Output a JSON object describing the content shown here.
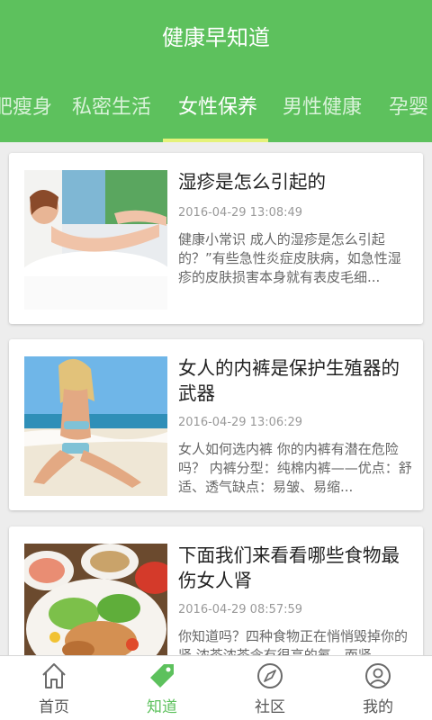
{
  "header": {
    "title": "健康早知道"
  },
  "tabs": [
    {
      "label": "肥瘦身"
    },
    {
      "label": "私密生活"
    },
    {
      "label": "女性保养"
    },
    {
      "label": "男性健康"
    },
    {
      "label": "孕婴"
    }
  ],
  "articles": [
    {
      "title": "湿疹是怎么引起的",
      "date": "2016-04-29 13:08:49",
      "summary": "健康小常识 成人的湿疹是怎么引起的？”有些急性炎症皮肤病，如急性湿疹的皮肤损害本身就有表皮毛细..."
    },
    {
      "title": "女人的内裤是保护生殖器的武器",
      "date": "2016-04-29 13:06:29",
      "summary": "女人如何选内裤 你的内裤有潜在危险吗？ 内裤分型：纯棉内裤——优点：舒适、透气缺点：易皱、易缩..."
    },
    {
      "title": "下面我们来看看哪些食物最伤女人肾",
      "date": "2016-04-29 08:57:59",
      "summary": "你知道吗？四种食物正在悄悄毁掉你的肾 浓茶浓茶含有很高的氟，而肾..."
    }
  ],
  "bottom_nav": [
    {
      "label": "首页",
      "icon": "home-icon"
    },
    {
      "label": "知道",
      "icon": "tag-icon"
    },
    {
      "label": "社区",
      "icon": "compass-icon"
    },
    {
      "label": "我的",
      "icon": "user-icon"
    }
  ],
  "colors": {
    "primary": "#5dc15d",
    "indicator": "#e5f27a"
  }
}
